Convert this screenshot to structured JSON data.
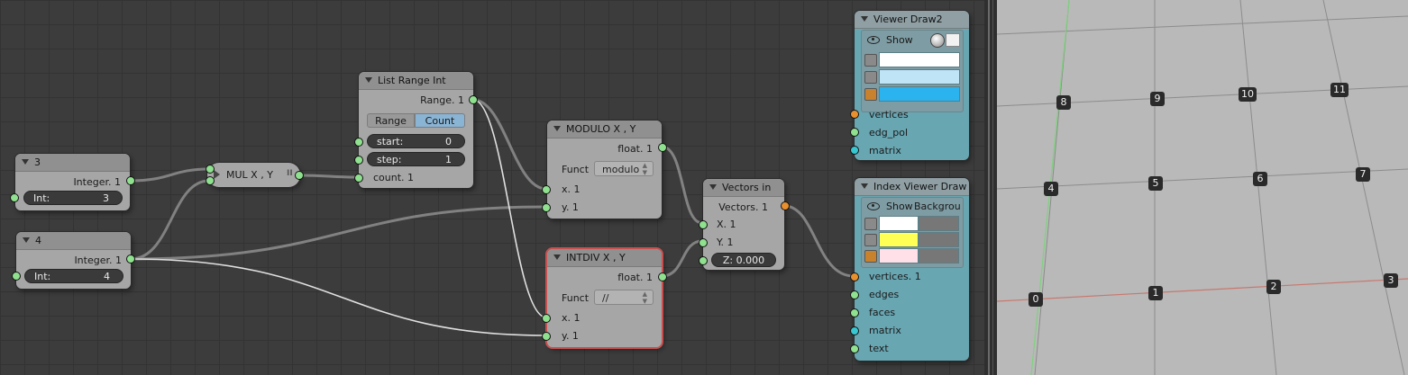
{
  "nodes": {
    "int3": {
      "title": "3",
      "output_label": "Integer. 1",
      "field_label": "Int:",
      "field_value": "3"
    },
    "int4": {
      "title": "4",
      "output_label": "Integer. 1",
      "field_label": "Int:",
      "field_value": "4"
    },
    "mul": {
      "title": "MUL X ,  Y",
      "pause_glyph": "II"
    },
    "list_range": {
      "title": "List Range Int",
      "output_label": "Range. 1",
      "mode_options": [
        "Range",
        "Count"
      ],
      "mode_selected": "Count",
      "start_label": "start:",
      "start_value": "0",
      "step_label": "step:",
      "step_value": "1",
      "count_label": "count. 1"
    },
    "modulo": {
      "title": "MODULO X ,  Y",
      "output_label": "float. 1",
      "funct_label": "Funct",
      "funct_value": "modulo",
      "x_label": "x. 1",
      "y_label": "y. 1"
    },
    "intdiv": {
      "title": "INTDIV X ,  Y",
      "output_label": "float. 1",
      "funct_label": "Funct",
      "funct_value": "//",
      "x_label": "x. 1",
      "y_label": "y. 1"
    },
    "vectors_in": {
      "title": "Vectors in",
      "output_label": "Vectors. 1",
      "x_label": "X. 1",
      "y_label": "Y. 1",
      "z_label": "Z: 0.000"
    },
    "viewer_draw": {
      "title": "Viewer Draw2",
      "show_label": "Show",
      "colors": [
        "#ffffff",
        "#bfe4f6",
        "#2ab3ee"
      ],
      "inputs": [
        "vertices",
        "edg_pol",
        "matrix"
      ]
    },
    "index_viewer": {
      "title": "Index Viewer Draw",
      "show_label": "Show",
      "background_label": "Backgrou",
      "colors": [
        "#ffffff",
        "#ffff55",
        "#ffe0e8"
      ],
      "inputs": [
        "vertices. 1",
        "edges",
        "faces",
        "matrix",
        "text"
      ]
    }
  },
  "colors": {
    "socket_green": "#8fe08f",
    "socket_orange": "#e8902e",
    "socket_cyan": "#38c6d0",
    "selected_outline": "#c85050",
    "x_axis": "#c8786e",
    "y_axis": "#7ed27e"
  },
  "viewport": {
    "vertex_labels": [
      "0",
      "1",
      "2",
      "3",
      "4",
      "5",
      "6",
      "7",
      "8",
      "9",
      "10",
      "11"
    ]
  }
}
